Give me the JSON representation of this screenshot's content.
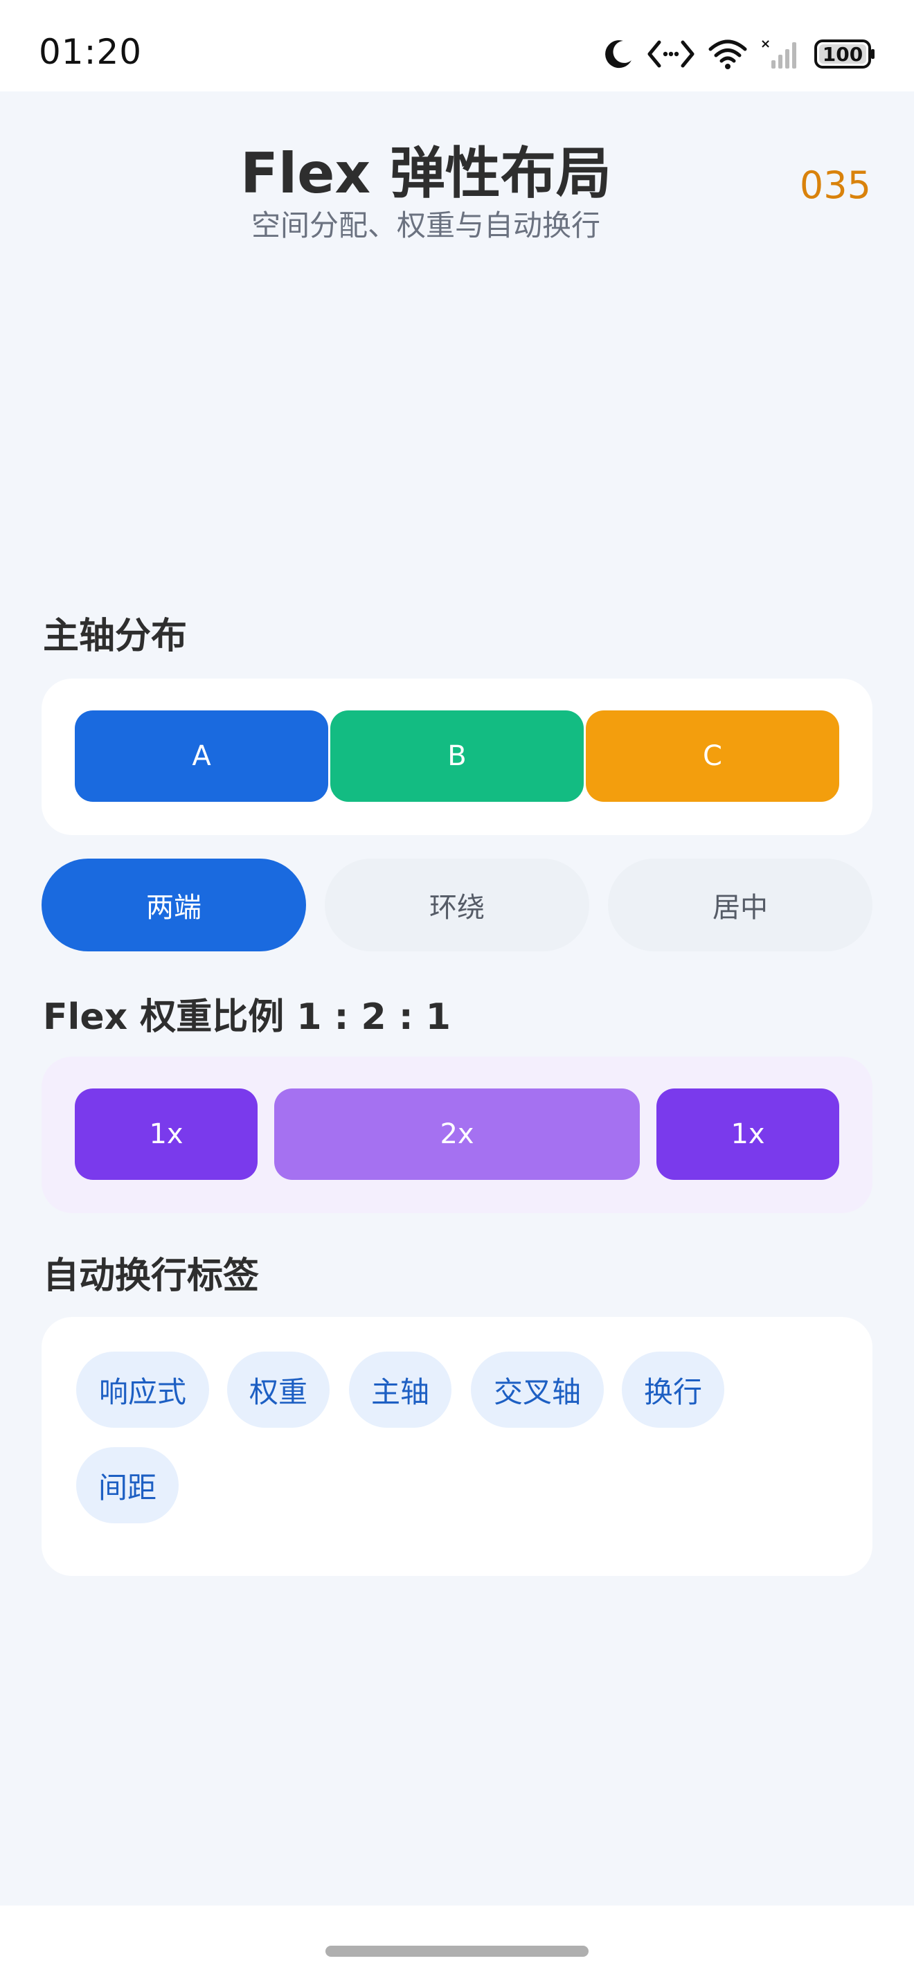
{
  "status_bar": {
    "time": "01:20",
    "battery": "100",
    "icons": [
      "moon-icon",
      "code-icon",
      "wifi-icon",
      "signal-icon",
      "battery-icon"
    ]
  },
  "header": {
    "title": "Flex 弹性布局",
    "subtitle": "空间分配、权重与自动换行",
    "counter": "035"
  },
  "main_axis": {
    "title": "主轴分布",
    "boxes": [
      {
        "label": "A",
        "color": "#1A6ADF"
      },
      {
        "label": "B",
        "color": "#13BC82"
      },
      {
        "label": "C",
        "color": "#F39E0D"
      }
    ],
    "options": [
      {
        "label": "两端",
        "active": true
      },
      {
        "label": "环绕",
        "active": false
      },
      {
        "label": "居中",
        "active": false
      }
    ]
  },
  "flex_weight": {
    "title": "Flex 权重比例 1 : 2 : 1",
    "items": [
      {
        "label": "1x",
        "color": "#7A3AEC"
      },
      {
        "label": "2x",
        "color": "#A571F1"
      },
      {
        "label": "1x",
        "color": "#7A3AEC"
      }
    ]
  },
  "wrap_tags": {
    "title": "自动换行标签",
    "tags": [
      "响应式",
      "权重",
      "主轴",
      "交叉轴",
      "换行",
      "间距"
    ]
  }
}
